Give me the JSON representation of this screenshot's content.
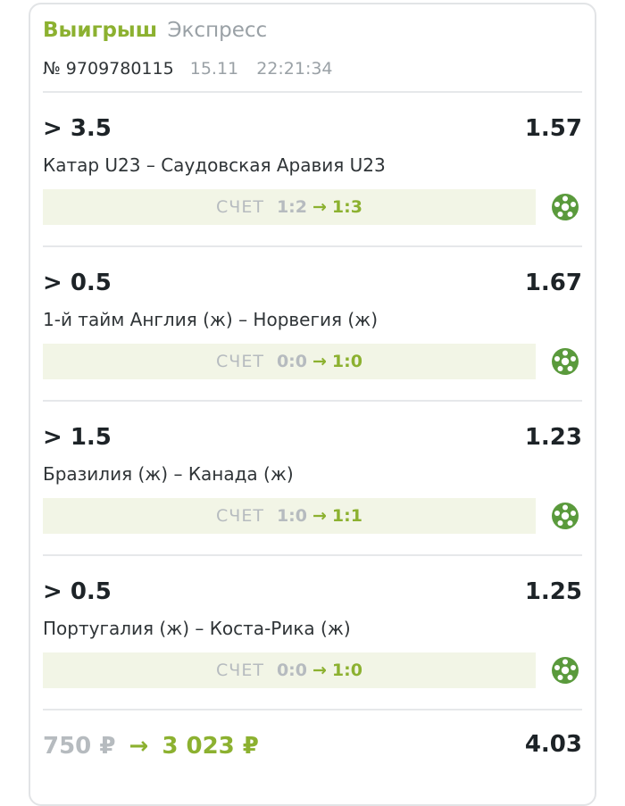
{
  "header": {
    "status": "Выигрыш",
    "bet_type": "Экспресс",
    "number": "№ 9709780115",
    "date": "15.11",
    "time": "22:21:34"
  },
  "score_label": "СЧЕТ",
  "arrow": "→",
  "bets": [
    {
      "market": "> 3.5",
      "odds": "1.57",
      "event": "Катар U23 – Саудовская Аравия U23",
      "score_from": "1:2",
      "score_to": "1:3",
      "sport_icon": "soccer-ball-icon"
    },
    {
      "market": "> 0.5",
      "odds": "1.67",
      "event": "1-й тайм Англия (ж) – Норвегия (ж)",
      "score_from": "0:0",
      "score_to": "1:0",
      "sport_icon": "soccer-ball-icon"
    },
    {
      "market": "> 1.5",
      "odds": "1.23",
      "event": "Бразилия (ж) – Канада (ж)",
      "score_from": "1:0",
      "score_to": "1:1",
      "sport_icon": "soccer-ball-icon"
    },
    {
      "market": "> 0.5",
      "odds": "1.25",
      "event": "Португалия (ж) – Коста-Рика (ж)",
      "score_from": "0:0",
      "score_to": "1:0",
      "sport_icon": "soccer-ball-icon"
    }
  ],
  "footer": {
    "stake": "750 ₽",
    "arrow": "→",
    "payout": "3 023 ₽",
    "total_odds": "4.03"
  },
  "colors": {
    "win_green": "#8cb130",
    "muted_grey": "#9aa1a6",
    "score_bg": "#f2f5e6",
    "icon_green": "#5a9a3c"
  }
}
